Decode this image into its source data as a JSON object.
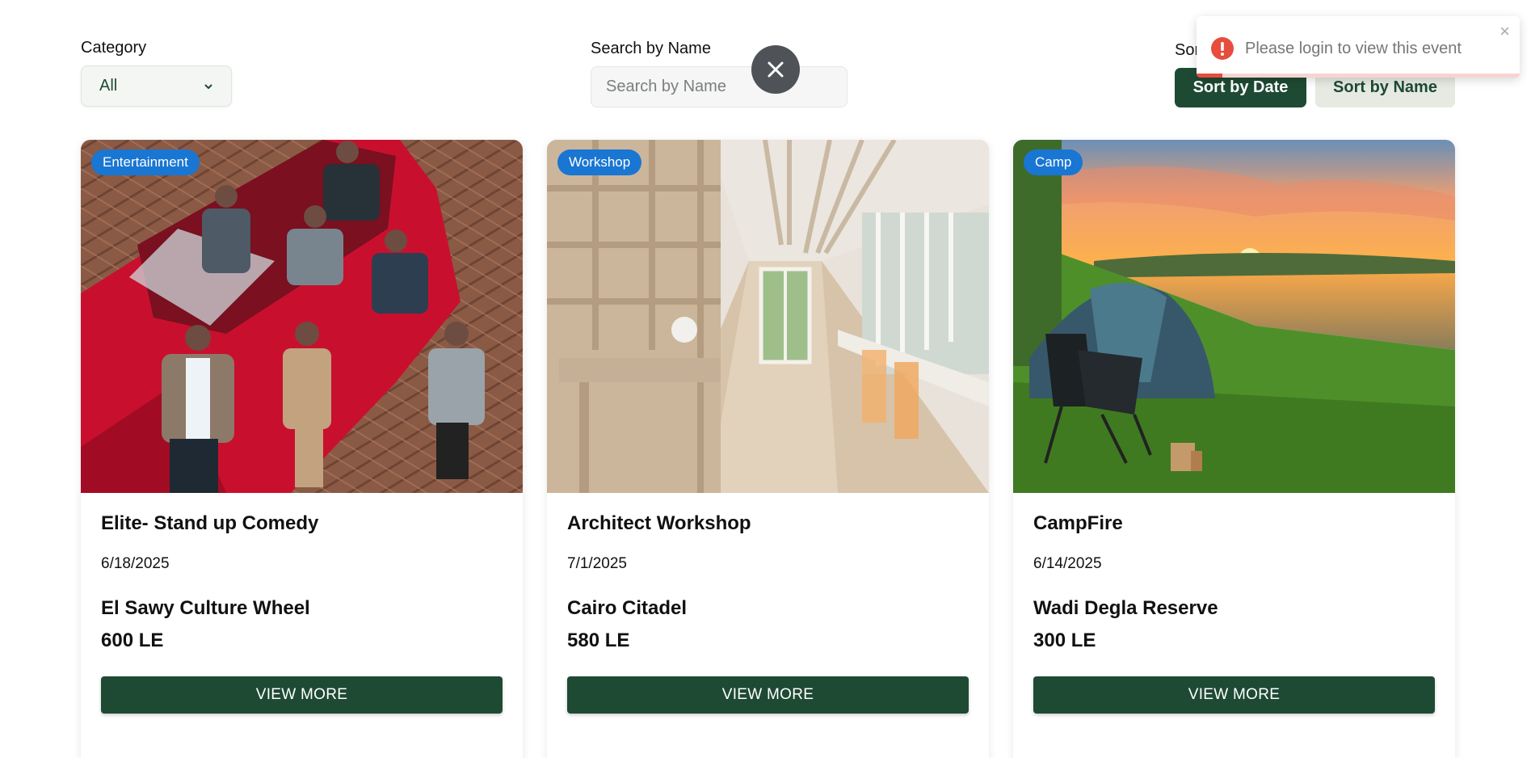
{
  "filters": {
    "category_label": "Category",
    "category_value": "All",
    "search_label": "Search by Name",
    "search_placeholder": "Search by Name",
    "sort_label": "Sort",
    "sort_by_date": "Sort by Date",
    "sort_by_name": "Sort by Name"
  },
  "toast": {
    "message": "Please login to view this event",
    "close_symbol": "×",
    "progress": 0.08,
    "accent": "#e74c3c"
  },
  "colors": {
    "primary": "#1e4a33",
    "badge": "#1976d2"
  },
  "events": [
    {
      "category": "Entertainment",
      "title": "Elite- Stand up Comedy",
      "date": "6/18/2025",
      "venue": "El Sawy Culture Wheel",
      "price": "600 LE",
      "cta": "VIEW MORE"
    },
    {
      "category": "Workshop",
      "title": "Architect Workshop",
      "date": "7/1/2025",
      "venue": "Cairo Citadel",
      "price": "580 LE",
      "cta": "VIEW MORE"
    },
    {
      "category": "Camp",
      "title": "CampFire",
      "date": "6/14/2025",
      "venue": "Wadi Degla Reserve",
      "price": "300 LE",
      "cta": "VIEW MORE"
    }
  ]
}
